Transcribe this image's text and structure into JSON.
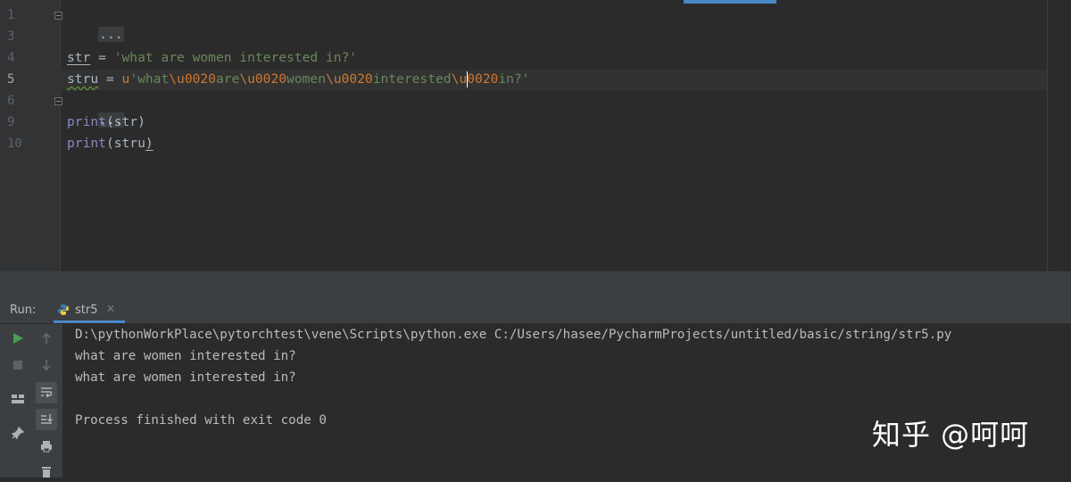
{
  "editor": {
    "line_numbers": [
      "1",
      "3",
      "4",
      "5",
      "6",
      "9",
      "10"
    ],
    "lines": [
      {
        "fold": "..."
      },
      {
        "text": ""
      },
      {
        "var": "str",
        "op": " = ",
        "string": "'what are women interested in?'"
      },
      {
        "var": "stru",
        "op": " = ",
        "prefix": "u",
        "parts": [
          "'what",
          "\\u0020",
          "are",
          "\\u0020",
          "women",
          "\\u0020",
          "interested",
          "\\u",
          "0020",
          "in?'"
        ]
      },
      {
        "fold": "..."
      },
      {
        "func": "print",
        "open": "(",
        "arg": "str",
        "close": ")"
      },
      {
        "func": "print",
        "open": "(",
        "arg": "stru",
        "close": ")"
      }
    ]
  },
  "run_panel": {
    "label": "Run:",
    "tab_name": "str5",
    "tab_close": "✕",
    "tab_icon": "python-file-icon"
  },
  "console": {
    "lines": [
      "D:\\pythonWorkPlace\\pytorchtest\\vene\\Scripts\\python.exe C:/Users/hasee/PycharmProjects/untitled/basic/string/str5.py",
      "what are women interested in?",
      "what are women interested in?",
      "",
      "Process finished with exit code 0"
    ]
  },
  "watermark": "知乎 @呵呵",
  "colors": {
    "editor_bg": "#2b2b2b",
    "gutter_bg": "#313335",
    "string": "#6a8759",
    "escape": "#cc7832",
    "identifier": "#a9b7c6",
    "builtin": "#8888c6",
    "run_green": "#499c54"
  }
}
